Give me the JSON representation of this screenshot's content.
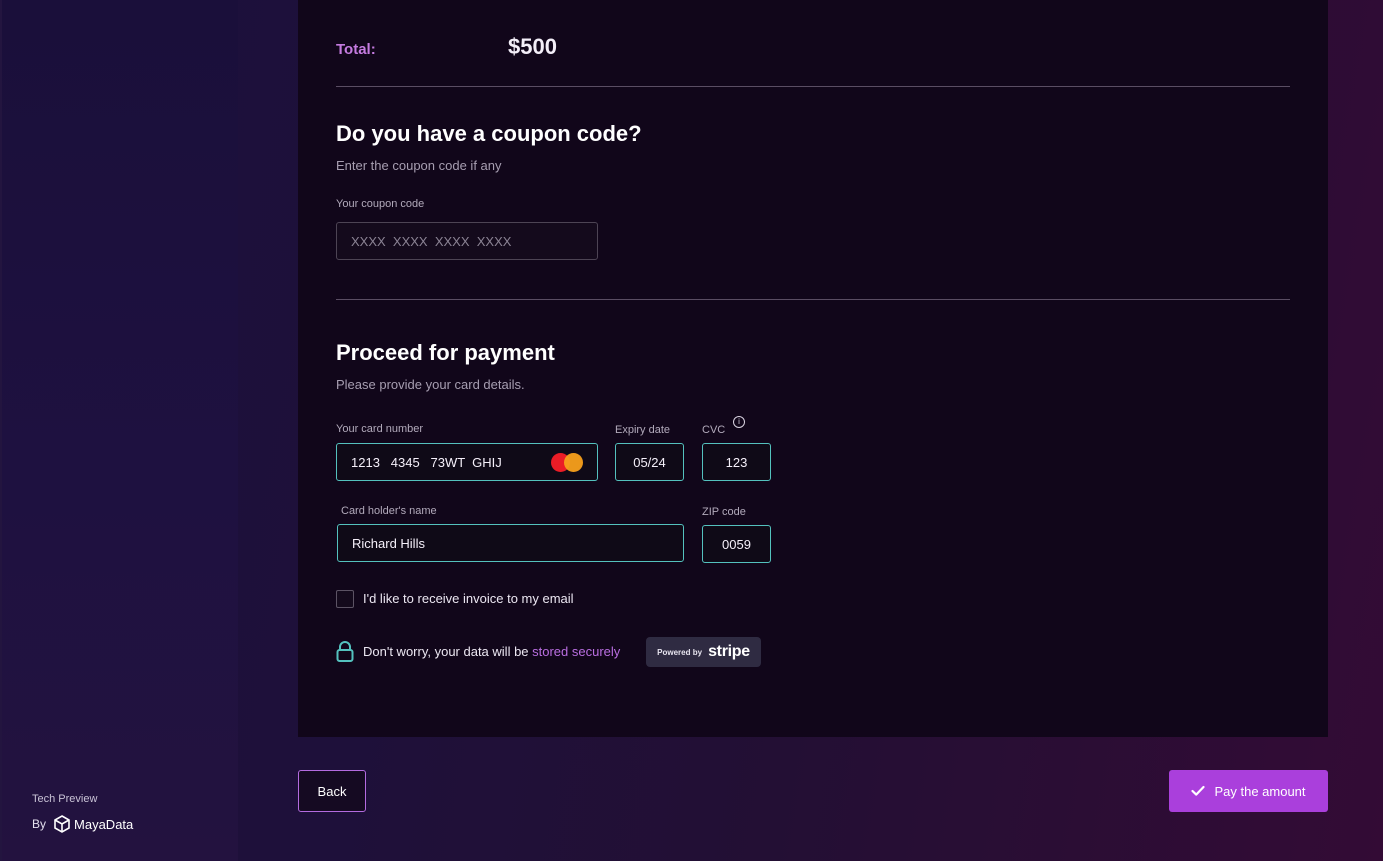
{
  "summary": {
    "total_label": "Total:",
    "total_value": "$500"
  },
  "coupon": {
    "heading": "Do you have a coupon code?",
    "subtitle": "Enter the coupon code if any",
    "field_label": "Your coupon code",
    "placeholder": "XXXX  XXXX  XXXX  XXXX"
  },
  "payment": {
    "heading": "Proceed for payment",
    "subtitle": "Please provide your card details.",
    "card_number_label": "Your card number",
    "card_number_value": "1213   4345   73WT  GHIJ",
    "expiry_label": "Expiry date",
    "expiry_value": "05/24",
    "cvc_label": "CVC",
    "cardholder_label": "Card holder's name",
    "cardholder_value": "Richard Hills",
    "zip_label": "ZIP code",
    "zip_value": "0059",
    "invoice_checkbox_label": "I'd like to receive invoice to my email",
    "invoice_checked": false,
    "security_text": "Don't worry, your data will be ",
    "security_link": "stored securely",
    "stripe_small": "Powered by",
    "stripe_word": "stripe"
  },
  "actions": {
    "back_label": "Back",
    "pay_label": "Pay the amount"
  },
  "sidebar": {
    "preview_text": "Tech Preview",
    "by_text": "By",
    "brand_name": "MayaData"
  },
  "colors": {
    "accent": "#aa3fdc",
    "teal": "#54c1be",
    "panel_bg": "#11061a"
  }
}
